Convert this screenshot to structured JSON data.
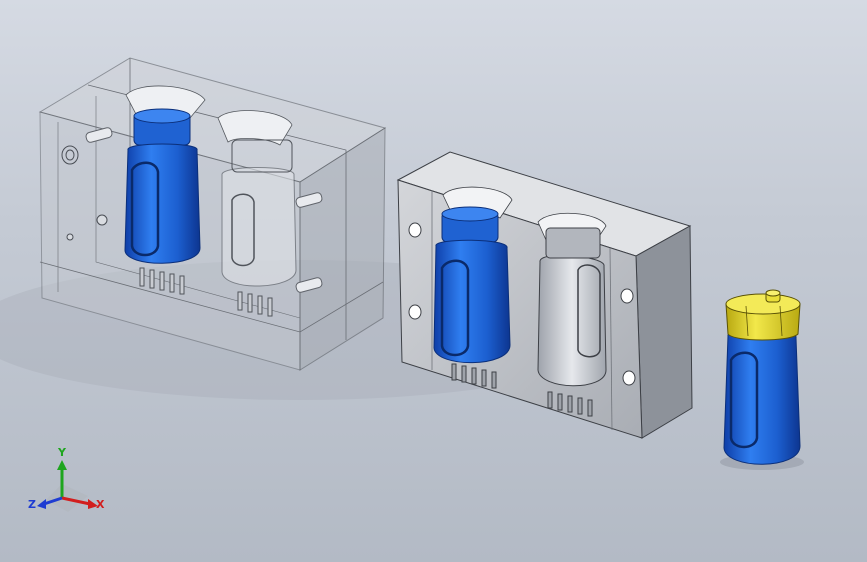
{
  "viewport": {
    "background_top": "#d5dae3",
    "background_bottom": "#b3bac5"
  },
  "scene": {
    "objects": [
      {
        "name": "transparent-mold-assembly",
        "color": "#c9ccd4"
      },
      {
        "name": "open-mold-half",
        "color": "#c6c8cd"
      },
      {
        "name": "blue-bottle-part",
        "color": "#1e63d6"
      },
      {
        "name": "yellow-bottle-cap",
        "color": "#e6db2e"
      }
    ]
  },
  "triad": {
    "x_label": "X",
    "y_label": "Y",
    "z_label": "Z",
    "x_color": "#d21e1e",
    "y_color": "#1ea51e",
    "z_color": "#1e3cd2"
  }
}
